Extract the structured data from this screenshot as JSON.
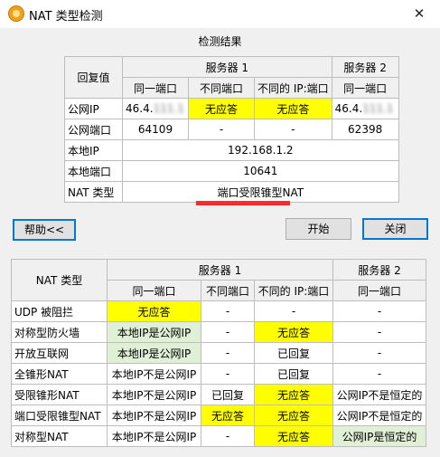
{
  "window": {
    "title": "NAT 类型检测",
    "close_glyph": "✕",
    "icon": "app-icon"
  },
  "caption": "检测结果",
  "top_table": {
    "reply_header": "回复值",
    "server1": "服务器 1",
    "server2": "服务器 2",
    "sub_same_port": "同一端口",
    "sub_diff_port": "不同端口",
    "sub_diff_ip_port": "不同的 IP:端口",
    "sub_same_port2": "同一端口",
    "rows": {
      "public_ip_label": "公网IP",
      "public_ip_s1_same": "46.4.",
      "public_ip_s1_diff_port": "无应答",
      "public_ip_s1_diff_ip": "无应答",
      "public_ip_s2_same": "46.4.",
      "public_port_label": "公网端口",
      "public_port_s1_same": "64109",
      "public_port_s1_diff_port": "-",
      "public_port_s1_diff_ip": "-",
      "public_port_s2_same": "62398",
      "local_ip_label": "本地IP",
      "local_ip_value": "192.168.1.2",
      "local_port_label": "本地端口",
      "local_port_value": "10641",
      "nat_type_label": "NAT 类型",
      "nat_type_value": "端口受限锥型NAT"
    }
  },
  "buttons": {
    "help": "帮助<<",
    "start": "开始",
    "close": "关闭"
  },
  "bottom_table": {
    "nat_type_header": "NAT 类型",
    "server1": "服务器 1",
    "server2": "服务器 2",
    "sub_same_port": "同一端口",
    "sub_diff_port": "不同端口",
    "sub_diff_ip_port": "不同的 IP:端口",
    "sub_same_port2": "同一端口",
    "rows": [
      {
        "type": "UDP 被阻拦",
        "c1": "无应答",
        "c2": "-",
        "c3": "-",
        "c4": "-"
      },
      {
        "type": "对称型防火墙",
        "c1": "本地IP是公网IP",
        "c2": "-",
        "c3": "无应答",
        "c4": "-"
      },
      {
        "type": "开放互联网",
        "c1": "本地IP是公网IP",
        "c2": "-",
        "c3": "已回复",
        "c4": "-"
      },
      {
        "type": "全锥形NAT",
        "c1": "本地IP不是公网IP",
        "c2": "-",
        "c3": "已回复",
        "c4": "-"
      },
      {
        "type": "受限锥形NAT",
        "c1": "本地IP不是公网IP",
        "c2": "已回复",
        "c3": "无应答",
        "c4": "公网IP不是恒定的"
      },
      {
        "type": "端口受限锥型NAT",
        "c1": "本地IP不是公网IP",
        "c2": "无应答",
        "c3": "无应答",
        "c4": "公网IP不是恒定的"
      },
      {
        "type": "对称型NAT",
        "c1": "本地IP不是公网IP",
        "c2": "-",
        "c3": "无应答",
        "c4": "公网IP是恒定的"
      }
    ]
  },
  "colors": {
    "highlight_yellow": "#ffff00",
    "highlight_green": "#dff0d6",
    "underline_red": "#ff2b2b",
    "default_button_border": "#0078d7"
  }
}
